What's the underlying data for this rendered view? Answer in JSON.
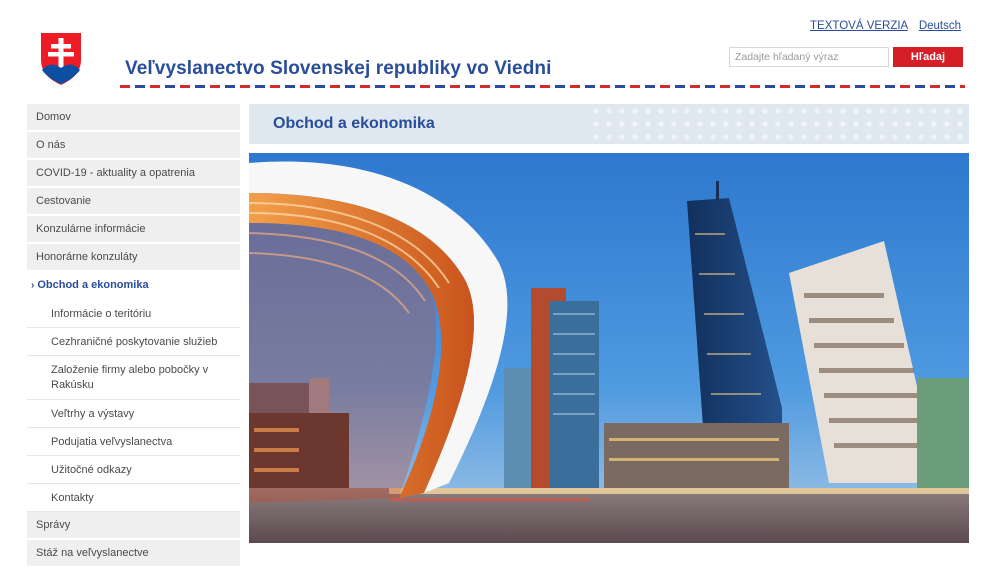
{
  "header": {
    "site_title": "Veľvyslanectvo Slovenskej republiky vo Viedni",
    "text_version_link": "TEXTOVÁ VERZIA",
    "language_link": "Deutsch",
    "search": {
      "placeholder": "Zadajte hľadaný výraz",
      "button_label": "Hľadaj"
    }
  },
  "sidebar": {
    "items": [
      {
        "label": "Domov"
      },
      {
        "label": "O nás"
      },
      {
        "label": "COVID-19 - aktuality a opatrenia"
      },
      {
        "label": "Cestovanie"
      },
      {
        "label": "Konzulárne informácie"
      },
      {
        "label": "Honorárne konzuláty"
      },
      {
        "label": "Obchod a ekonomika",
        "marker": "›"
      },
      {
        "label": "Informácie o teritóriu"
      },
      {
        "label": "Cezhraničné poskytovanie služieb"
      },
      {
        "label": "Založenie firmy alebo pobočky v Rakúsku"
      },
      {
        "label": "Veľtrhy a výstavy"
      },
      {
        "label": "Podujatia veľvyslanectva"
      },
      {
        "label": "Užitočné odkazy"
      },
      {
        "label": "Kontakty"
      },
      {
        "label": "Správy"
      },
      {
        "label": "Stáž na veľvyslanectve"
      }
    ]
  },
  "main": {
    "page_title": "Obchod a ekonomika",
    "hero_image": "vienna-skyline-photo"
  },
  "colors": {
    "brand_blue": "#2a4d9b",
    "brand_red": "#d31f25",
    "banner_bg": "#dfe7f1",
    "sidebar_bg": "#efefef"
  }
}
